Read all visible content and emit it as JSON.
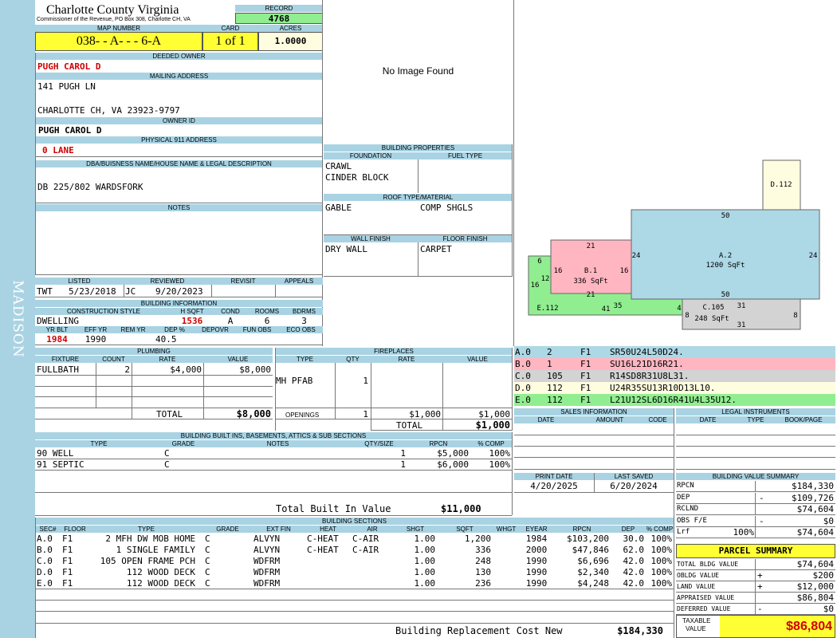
{
  "header": {
    "county": "Charlotte County Virginia",
    "commissioner": "Commissioner of the Revenue, PO Box 308, Charlotte CH, VA",
    "record_label": "RECORD",
    "record": "4768",
    "sidebar": "MADISON"
  },
  "map": {
    "map_label": "MAP NUMBER",
    "map": "038- - A- - - 6-A",
    "card_label": "CARD",
    "card": "1 of 1",
    "acres_label": "ACRES",
    "acres": "1.0000"
  },
  "owner": {
    "deeded_label": "DEEDED OWNER",
    "deeded": "PUGH CAROL D",
    "mailing_label": "MAILING ADDRESS",
    "addr1": "141 PUGH LN",
    "addr2": "CHARLOTTE CH, VA 23923-9797",
    "owner_id_label": "OWNER ID",
    "owner_id": "PUGH CAROL D",
    "phys_label": "PHYSICAL 911 ADDRESS",
    "phys": "0 LANE",
    "dba_label": "DBA/BUISNESS NAME/HOUSE NAME & LEGAL DESCRIPTION",
    "dba": "DB 225/802 WARDSFORK",
    "notes_label": "NOTES"
  },
  "image": {
    "text": "No Image Found"
  },
  "status": {
    "listed_label": "LISTED",
    "listed_by": "TWT",
    "listed": "5/23/2018",
    "reviewed_label": "REVIEWED",
    "reviewed_by": "JC",
    "reviewed": "9/20/2023",
    "revisit_label": "REVISIT",
    "appeals_label": "APPEALS"
  },
  "bldg_info": {
    "label": "BUILDING INFORMATION",
    "style_label": "CONSTRUCTION STYLE",
    "hsqft_label": "H SQFT",
    "cond_label": "COND",
    "rooms_label": "ROOMS",
    "bdrms_label": "BDRMS",
    "style": "DWELLING",
    "hsqft": "1536",
    "cond": "A",
    "rooms": "6",
    "bdrms": "3",
    "yrblt_label": "YR BLT",
    "effyr_label": "EFF YR",
    "remyr_label": "REM YR",
    "dep_label": "DEP %",
    "depovr_label": "DEPOVR",
    "funobs_label": "FUN OBS",
    "ecoobs_label": "ECO OBS",
    "yrblt": "1984",
    "effyr": "1990",
    "dep": "40.5"
  },
  "bldg_props": {
    "label": "BUILDING PROPERTIES",
    "foundation_label": "FOUNDATION",
    "fuel_label": "FUEL TYPE",
    "foundation1": "CRAWL",
    "foundation2": "CINDER BLOCK",
    "roof_label": "ROOF TYPE/MATERIAL",
    "roof1": "GABLE",
    "roof2": "COMP SHGLS",
    "wall_label": "WALL FINISH",
    "floor_label": "FLOOR FINISH",
    "wall": "DRY WALL",
    "floor": "CARPET"
  },
  "sketch": {
    "labels": [
      {
        "id": "D.112"
      },
      {
        "id": "A.2",
        "sqft": "1200 SqFt"
      },
      {
        "id": "B.1",
        "sqft": "336 SqFt"
      },
      {
        "id": "C.105",
        "sqft": "248 SqFt"
      },
      {
        "id": "E.112"
      }
    ],
    "dims": [
      "50",
      "24",
      "24",
      "50",
      "21",
      "21",
      "16",
      "16",
      "6",
      "12",
      "16",
      "41",
      "35",
      "4",
      "31",
      "31",
      "8",
      "8"
    ]
  },
  "sketch_codes": [
    {
      "sec": "A.0",
      "n": "2",
      "fl": "F1",
      "code": "SR50U24L50D24.",
      "color": "#add8e6"
    },
    {
      "sec": "B.0",
      "n": "1",
      "fl": "F1",
      "code": "SU16L21D16R21.",
      "color": "#ffb6c1"
    },
    {
      "sec": "C.0",
      "n": "105",
      "fl": "F1",
      "code": "R14SD8R31U8L31.",
      "color": "#d3d3d3"
    },
    {
      "sec": "D.0",
      "n": "112",
      "fl": "F1",
      "code": "U24R35SU13R10D13L10.",
      "color": "#fffde0"
    },
    {
      "sec": "E.0",
      "n": "112",
      "fl": "F1",
      "code": "L21U12SL6D16R41U4L35U12.",
      "color": "#90ee90"
    }
  ],
  "plumbing": {
    "label": "PLUMBING",
    "cols": [
      "FIXTURE",
      "COUNT",
      "RATE",
      "VALUE"
    ],
    "rows": [
      [
        "FULLBATH",
        "2",
        "$4,000",
        "$8,000"
      ]
    ],
    "total_label": "TOTAL",
    "total": "$8,000"
  },
  "fireplaces": {
    "label": "FIREPLACES",
    "cols": [
      "TYPE",
      "QTY",
      "RATE",
      "VALUE"
    ],
    "rows": [
      [
        "MH PFAB",
        "1",
        "",
        ""
      ]
    ],
    "openings_label": "OPENINGS",
    "openings": [
      "1",
      "$1,000",
      "$1,000"
    ],
    "total_label": "TOTAL",
    "total": "$1,000"
  },
  "sales": {
    "label": "SALES INFORMATION",
    "cols": [
      "DATE",
      "AMOUNT",
      "CODE"
    ]
  },
  "legal": {
    "label": "LEGAL INSTRUMENTS",
    "cols": [
      "DATE",
      "TYPE",
      "BOOK/PAGE"
    ]
  },
  "builtins": {
    "label": "BUILDING BUILT INS, BASEMENTS, ATTICS & SUB SECTIONS",
    "cols": [
      "TYPE",
      "GRADE",
      "NOTES",
      "QTY/SIZE",
      "RPCN",
      "% COMP"
    ],
    "rows": [
      [
        "90 WELL",
        "C",
        "",
        "1",
        "$5,000",
        "100%"
      ],
      [
        "91 SEPTIC",
        "C",
        "",
        "1",
        "$6,000",
        "100%"
      ]
    ],
    "total_label": "Total Built In Value",
    "total": "$11,000"
  },
  "dates": {
    "print_label": "PRINT DATE",
    "print": "4/20/2025",
    "saved_label": "LAST SAVED",
    "saved": "6/20/2024"
  },
  "value_summary": {
    "label": "BUILDING VALUE SUMMARY",
    "rows": [
      [
        "RPCN",
        "",
        "$184,330"
      ],
      [
        "DEP",
        "-",
        "$109,726"
      ],
      [
        "RCLND",
        "",
        "$74,604"
      ],
      [
        "OBS F/E",
        "-",
        "$0"
      ],
      [
        "Lrf",
        "100%",
        "$74,604"
      ]
    ]
  },
  "parcel": {
    "label": "PARCEL SUMMARY",
    "rows": [
      [
        "TOTAL BLDG VALUE",
        "",
        "$74,604"
      ],
      [
        "OBLDG VALUE",
        "+",
        "$200"
      ],
      [
        "LAND VALUE",
        "+",
        "$12,000"
      ],
      [
        "APPRAISED VALUE",
        "",
        "$86,804"
      ],
      [
        "DEFERRED VALUE",
        "-",
        "$0"
      ]
    ],
    "taxable_label1": "TAXABLE",
    "taxable_label2": "VALUE",
    "taxable": "$86,804"
  },
  "sections": {
    "label": "BUILDING SECTIONS",
    "cols": [
      "SEC#",
      "FLOOR",
      "TYPE",
      "GRADE",
      "EXT FIN",
      "HEAT",
      "AIR",
      "SHGT",
      "SQFT",
      "WHGT",
      "EYEAR",
      "RPCN",
      "DEP",
      "% COMP"
    ],
    "rows": [
      [
        "A.0",
        "F1",
        "2 MFH DW MOB HOME",
        "C",
        "ALVYN",
        "C-HEAT",
        "C-AIR",
        "1.00",
        "1,200",
        "",
        "1984",
        "$103,200",
        "30.0",
        "100%"
      ],
      [
        "B.0",
        "F1",
        "1 SINGLE FAMILY",
        "C",
        "ALVYN",
        "C-HEAT",
        "C-AIR",
        "1.00",
        "336",
        "",
        "2000",
        "$47,846",
        "62.0",
        "100%"
      ],
      [
        "C.0",
        "F1",
        "105 OPEN FRAME PCH",
        "C",
        "WDFRM",
        "",
        "",
        "1.00",
        "248",
        "",
        "1990",
        "$6,696",
        "42.0",
        "100%"
      ],
      [
        "D.0",
        "F1",
        "112 WOOD DECK",
        "C",
        "WDFRM",
        "",
        "",
        "1.00",
        "130",
        "",
        "1990",
        "$2,340",
        "42.0",
        "100%"
      ],
      [
        "E.0",
        "F1",
        "112 WOOD DECK",
        "C",
        "WDFRM",
        "",
        "",
        "1.00",
        "236",
        "",
        "1990",
        "$4,248",
        "42.0",
        "100%"
      ]
    ],
    "total_label": "Building Replacement Cost New",
    "total": "$184,330"
  }
}
